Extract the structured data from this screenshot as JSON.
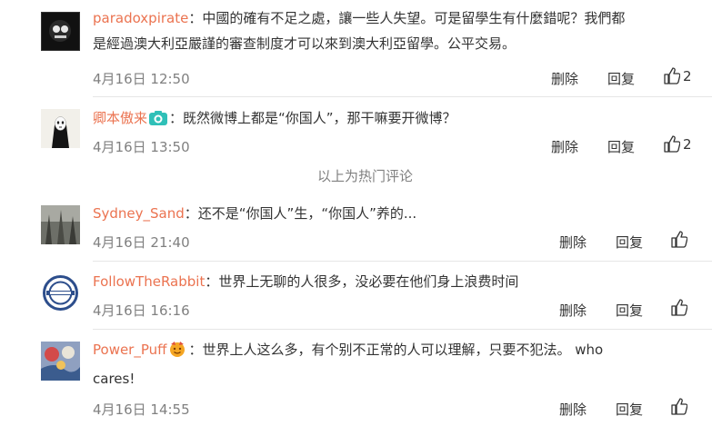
{
  "comments": [
    {
      "username": "paradoxpirate",
      "text": "：中國的確有不足之處，讓一些人失望。可是留學生有什麼錯呢？我們都",
      "text2": "是經過澳大利亞嚴謹的審查制度才可以來到澳大利亞留學。公平交易。",
      "time": "4月16日 12:50",
      "delete_label": "删除",
      "reply_label": "回复",
      "likes": "2"
    },
    {
      "username": "卿本傲来",
      "text": "：既然微博上都是“你国人”，那干嘛要开微博？",
      "time": "4月16日 13:50",
      "delete_label": "删除",
      "reply_label": "回复",
      "likes": "2"
    },
    {
      "username": "Sydney_Sand",
      "text": "：还不是“你国人”生，“你国人”养的...",
      "time": "4月16日 21:40",
      "delete_label": "删除",
      "reply_label": "回复"
    },
    {
      "username": "FollowTheRabbit",
      "text": "：世界上无聊的人很多，没必要在他们身上浪费时间",
      "time": "4月16日 16:16",
      "delete_label": "删除",
      "reply_label": "回复"
    },
    {
      "username": "Power_Puff",
      "text": "：世界上人这么多，有个别不正常的人可以理解，只要不犯法。 who",
      "text2": "cares!",
      "time": "4月16日 14:55",
      "delete_label": "删除",
      "reply_label": "回复"
    }
  ],
  "hot_comments_label": "以上为热门评论",
  "colors": {
    "username": "#eb7350",
    "meta": "#808080",
    "divider": "#e6e6e6"
  },
  "icons": [
    "like-icon",
    "camera-badge-icon",
    "emoji-badge-icon"
  ]
}
